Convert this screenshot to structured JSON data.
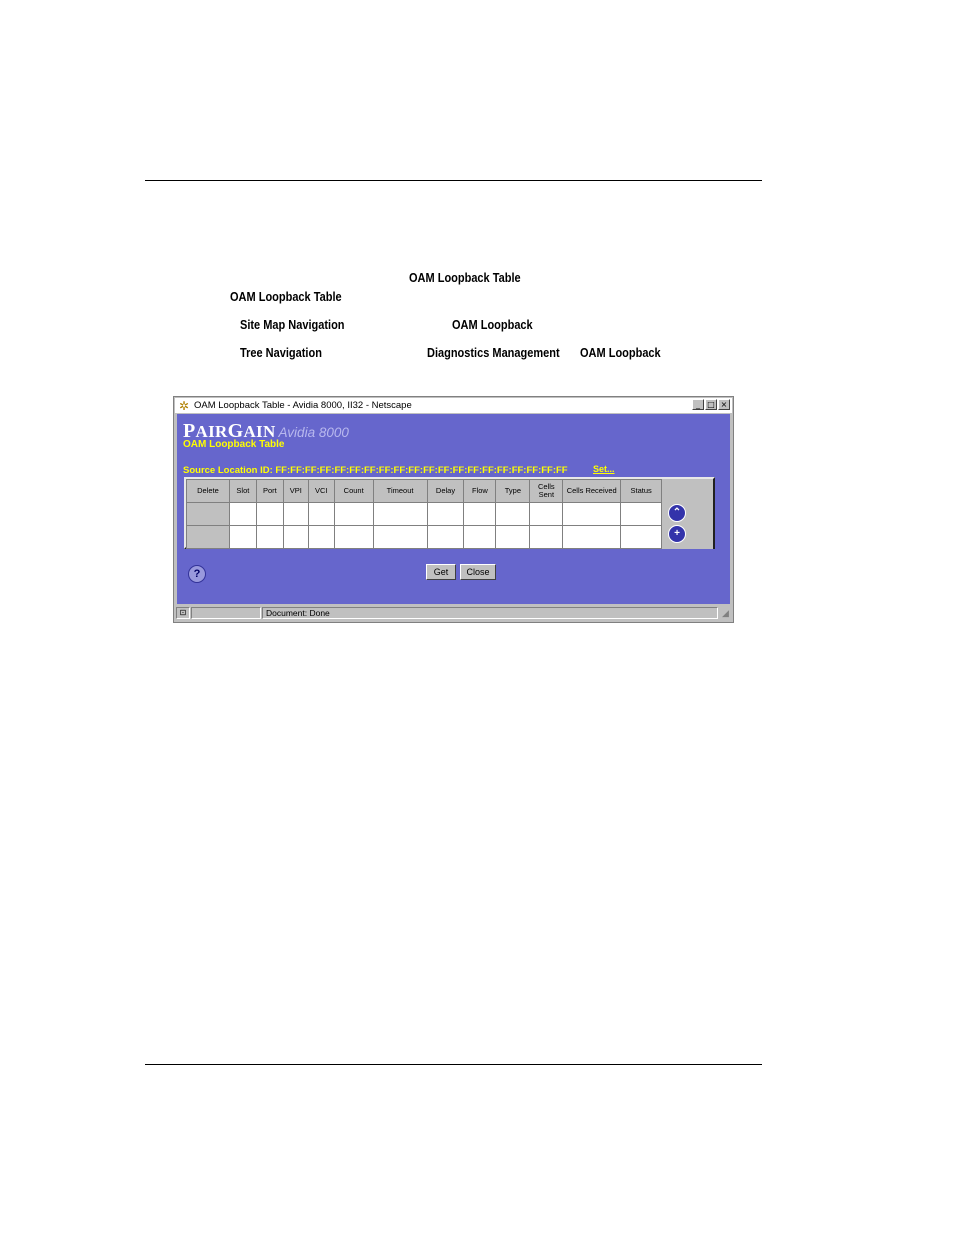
{
  "doc": {
    "line1_term": "OAM Loopback Table",
    "line2_term": "OAM Loopback Table",
    "site_map": {
      "label": "Site Map Navigation",
      "target": "OAM Loopback"
    },
    "tree": {
      "label": "Tree Navigation",
      "target_menu": "Diagnostics Management",
      "target": "OAM Loopback"
    }
  },
  "window": {
    "title": "OAM Loopback Table - Avidia 8000, II32 - Netscape",
    "minimize": "_",
    "maximize": "□",
    "close": "×"
  },
  "page": {
    "logo_pair": "AIR",
    "logo_p": "P",
    "logo_g": "G",
    "logo_ain": "AIN",
    "logo_product": "Avidia 8000",
    "subtitle": "OAM Loopback Table",
    "source_label": "Source Location ID:",
    "source_value": "FF:FF:FF:FF:FF:FF:FF:FF:FF:FF:FF:FF:FF:FF:FF:FF:FF:FF:FF:FF",
    "source_link": "Set..."
  },
  "table": {
    "columns": [
      "Delete",
      "Slot",
      "Port",
      "VPI",
      "VCI",
      "Count",
      "Timeout",
      "Delay",
      "Flow",
      "Type",
      "Cells Sent",
      "Cells Received",
      "Status"
    ],
    "rows": [
      [
        "",
        "",
        "",
        "",
        "",
        "",
        "",
        "",
        "",
        "",
        "",
        "",
        ""
      ],
      [
        "",
        "",
        "",
        "",
        "",
        "",
        "",
        "",
        "",
        "",
        "",
        "",
        ""
      ]
    ]
  },
  "icons": {
    "scroll_up": "double-chevron-up-icon",
    "add_row": "plus-icon",
    "help": "question-mark-icon"
  },
  "buttons": {
    "get": "Get",
    "close": "Close",
    "help": "?"
  },
  "status": {
    "message": "Document: Done"
  }
}
